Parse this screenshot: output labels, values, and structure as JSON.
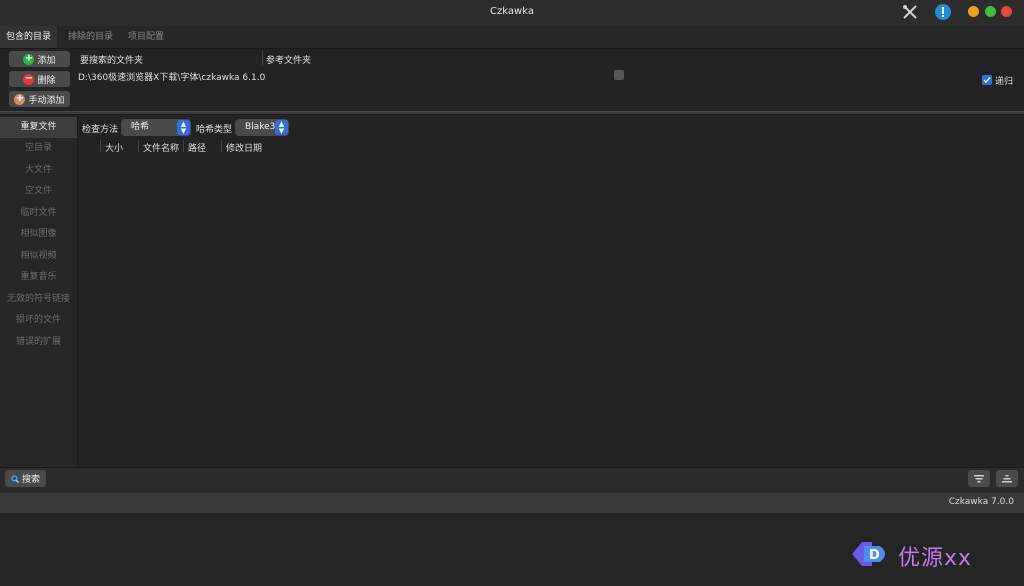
{
  "window": {
    "title": "Czkawka"
  },
  "tabs": [
    {
      "label": "包含的目录",
      "active": true
    },
    {
      "label": "排除的目录",
      "active": false
    },
    {
      "label": "项目配置",
      "active": false
    }
  ],
  "directories": {
    "buttons": {
      "add": "添加",
      "remove": "删除",
      "manual_add": "手动添加"
    },
    "column_search": "要搜索的文件夹",
    "column_reference": "参考文件夹",
    "rows": [
      {
        "path": "D:\\360极速浏览器X下载\\字体\\czkawka 6.1.0",
        "reference": false
      }
    ],
    "recursive_label": "递归",
    "recursive_checked": true
  },
  "tools": [
    {
      "label": "重复文件",
      "active": true
    },
    {
      "label": "空目录",
      "active": false
    },
    {
      "label": "大文件",
      "active": false
    },
    {
      "label": "空文件",
      "active": false
    },
    {
      "label": "临时文件",
      "active": false
    },
    {
      "label": "相似图像",
      "active": false
    },
    {
      "label": "相似视频",
      "active": false
    },
    {
      "label": "重复音乐",
      "active": false
    },
    {
      "label": "无效的符号链接",
      "active": false
    },
    {
      "label": "损坏的文件",
      "active": false
    },
    {
      "label": "错误的扩展",
      "active": false
    }
  ],
  "options": {
    "check_method_label": "检查方法",
    "check_method_value": "哈希",
    "hash_type_label": "哈希类型",
    "hash_type_value": "Blake3"
  },
  "results_columns": [
    "大小",
    "文件名称",
    "路径",
    "修改日期"
  ],
  "bottom": {
    "search_label": "搜索"
  },
  "status": {
    "version": "Czkawka 7.0.0"
  },
  "watermark": {
    "text": "优源xx"
  },
  "colors": {
    "accent": "#2f6fe0",
    "add": "#2fb44a",
    "remove": "#e0393b",
    "manual": "#d08a6a"
  }
}
